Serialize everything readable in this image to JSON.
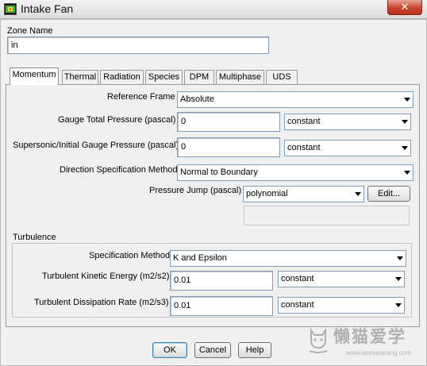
{
  "window": {
    "title": "Intake Fan",
    "close_glyph": "✕"
  },
  "zone": {
    "label": "Zone Name",
    "value": "in"
  },
  "tabs": [
    {
      "label": "Momentum",
      "active": true
    },
    {
      "label": "Thermal"
    },
    {
      "label": "Radiation"
    },
    {
      "label": "Species"
    },
    {
      "label": "DPM"
    },
    {
      "label": "Multiphase"
    },
    {
      "label": "UDS"
    }
  ],
  "momentum": {
    "reference_frame": {
      "label": "Reference Frame",
      "value": "Absolute"
    },
    "gauge_total_pressure": {
      "label": "Gauge Total Pressure (pascal)",
      "value": "0",
      "method": "constant"
    },
    "supersonic_pressure": {
      "label": "Supersonic/Initial Gauge Pressure (pascal)",
      "value": "0",
      "method": "constant"
    },
    "direction_method": {
      "label": "Direction Specification Method",
      "value": "Normal to Boundary"
    },
    "pressure_jump": {
      "label": "Pressure Jump (pascal)",
      "value": "polynomial",
      "edit_label": "Edit..."
    }
  },
  "turbulence": {
    "title": "Turbulence",
    "spec_method": {
      "label": "Specification Method",
      "value": "K and Epsilon"
    },
    "kinetic_energy": {
      "label": "Turbulent Kinetic Energy (m2/s2)",
      "value": "0.01",
      "method": "constant"
    },
    "dissipation_rate": {
      "label": "Turbulent Dissipation Rate (m2/s3)",
      "value": "0.01",
      "method": "constant"
    }
  },
  "buttons": {
    "ok": "OK",
    "cancel": "Cancel",
    "help": "Help"
  },
  "watermark": {
    "text": "懒猫爱学",
    "url": "www.lanmaowang.com"
  },
  "icons": {
    "app": "fluent-app-icon",
    "arrow": "dropdown-arrow-icon"
  },
  "colors": {
    "close": "#c9442e",
    "input_border": "#7f9db9",
    "panel": "#f0f0f0"
  }
}
